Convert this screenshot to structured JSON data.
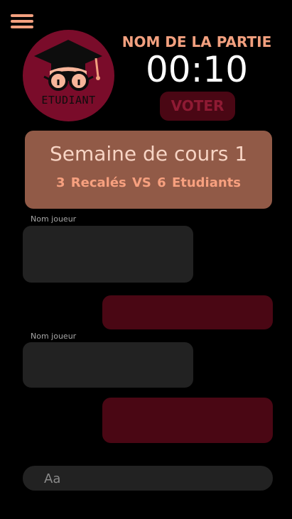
{
  "header": {
    "role_badge": {
      "icon": "graduation-student-icon",
      "label": "ETUDIANT"
    },
    "game_name": "NOM DE LA PARTIE",
    "timer": "00:10",
    "vote_label": "VOTER"
  },
  "round": {
    "title": "Semaine de cours 1",
    "score": "3 Recalés  VS  6 Etudiants"
  },
  "messages": [
    {
      "player_label": "Nom joueur"
    },
    {
      "player_label": "Nom joueur"
    }
  ],
  "chat": {
    "placeholder": "Aa"
  },
  "colors": {
    "background": "#000000",
    "accent": "#F2A07F",
    "badge": "#7A0C2A",
    "vote_button": "#4A0714",
    "round_card": "#915A47",
    "message_in": "#222222",
    "message_out": "#4A0714"
  }
}
